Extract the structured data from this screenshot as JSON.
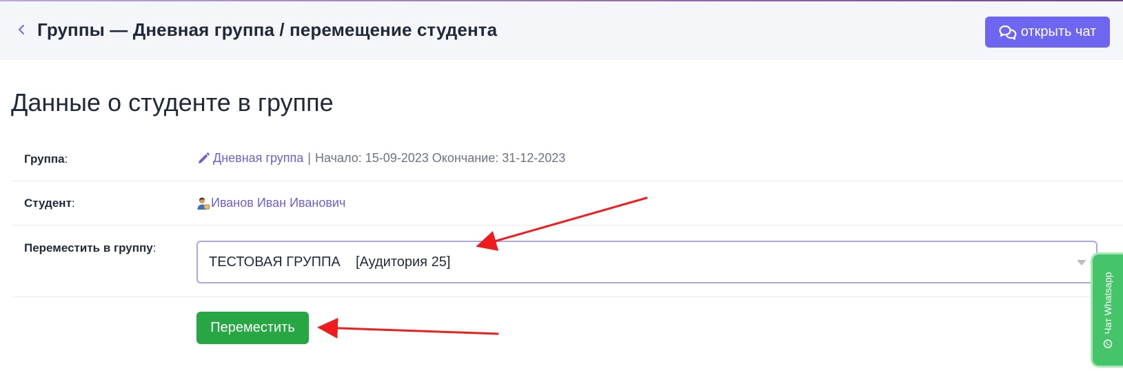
{
  "header": {
    "title": "Группы — Дневная группа / перемещение студента",
    "chat_button_label": "открыть чат"
  },
  "section": {
    "title": "Данные о студенте в группе"
  },
  "rows": {
    "group": {
      "label": "Группа",
      "colon": ":",
      "link_text": "Дневная группа",
      "separator": "|",
      "dates_text": "Начало: 15-09-2023 Окончание: 31-12-2023"
    },
    "student": {
      "label": "Студент",
      "colon": ":",
      "link_text": "Иванов Иван Иванович"
    },
    "move_to": {
      "label": "Переместить в группу",
      "colon": ":",
      "selected_value": "ТЕСТОВАЯ ГРУППА    [Аудитория 25]"
    }
  },
  "actions": {
    "move_button_label": "Переместить"
  },
  "whatsapp_tab": {
    "label": "Чат Whatsapp"
  },
  "colors": {
    "accent": "#6e66f0",
    "link": "#6a5fd6",
    "success": "#27a644",
    "whatsapp": "#45c46a",
    "annotation_arrow": "#ee1c1c"
  },
  "icons": {
    "back": "chevron-left-icon",
    "chat": "chat-bubbles-icon",
    "edit": "pencil-icon",
    "student": "student-icon",
    "dropdown": "caret-down-icon",
    "whatsapp": "whatsapp-icon"
  }
}
